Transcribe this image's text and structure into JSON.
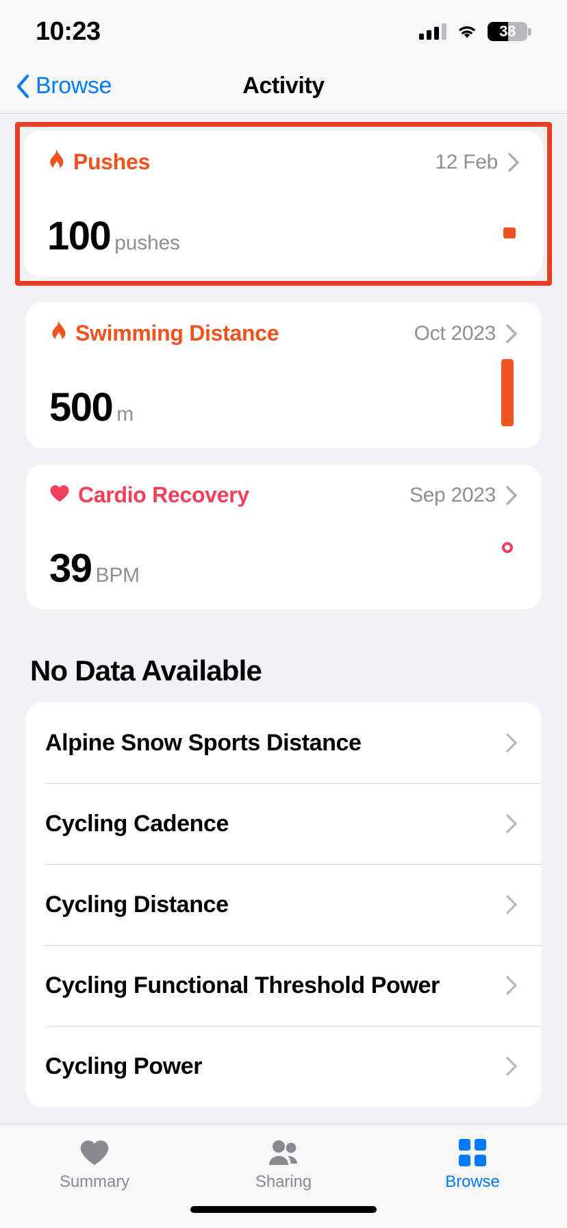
{
  "status_bar": {
    "time": "10:23",
    "battery_percent": "38",
    "signal_icon": "cellular-signal-icon",
    "wifi_icon": "wifi-icon",
    "battery_icon": "battery-icon"
  },
  "nav": {
    "back_label": "Browse",
    "back_icon": "chevron-left-icon",
    "title": "Activity"
  },
  "colors": {
    "accent_blue": "#007aff",
    "activity_orange": "#f0521f",
    "heart_red": "#f2405c",
    "highlight_border": "#ea3b23",
    "secondary_text": "#8e8e93",
    "page_background": "#f2f1f6"
  },
  "highlighted_card_index": 0,
  "cards": [
    {
      "icon": "flame-icon",
      "icon_color": "#f0521f",
      "title": "Pushes",
      "title_color": "orange",
      "date": "12 Feb",
      "value": "100",
      "unit": "pushes",
      "chevron_icon": "chevron-right-icon",
      "spark": {
        "kind": "bar-small",
        "color": "#f0521f"
      }
    },
    {
      "icon": "flame-icon",
      "icon_color": "#f0521f",
      "title": "Swimming Distance",
      "title_color": "orange",
      "date": "Oct 2023",
      "value": "500",
      "unit": "m",
      "chevron_icon": "chevron-right-icon",
      "spark": {
        "kind": "bar-tall",
        "color": "#ee5523"
      }
    },
    {
      "icon": "heart-icon",
      "icon_color": "#f2405c",
      "title": "Cardio Recovery",
      "title_color": "red",
      "date": "Sep 2023",
      "value": "39",
      "unit": "BPM",
      "chevron_icon": "chevron-right-icon",
      "spark": {
        "kind": "dot-ring",
        "color": "#f2405c"
      }
    }
  ],
  "no_data": {
    "section_title": "No Data Available",
    "items": [
      {
        "label": "Alpine Snow Sports Distance",
        "chevron_icon": "chevron-right-icon"
      },
      {
        "label": "Cycling Cadence",
        "chevron_icon": "chevron-right-icon"
      },
      {
        "label": "Cycling Distance",
        "chevron_icon": "chevron-right-icon"
      },
      {
        "label": "Cycling Functional Threshold Power",
        "chevron_icon": "chevron-right-icon"
      },
      {
        "label": "Cycling Power",
        "chevron_icon": "chevron-right-icon"
      }
    ]
  },
  "tabbar": {
    "tabs": [
      {
        "label": "Summary",
        "icon": "heart-icon",
        "active": false
      },
      {
        "label": "Sharing",
        "icon": "two-people-icon",
        "active": false
      },
      {
        "label": "Browse",
        "icon": "grid-squares-icon",
        "active": true
      }
    ]
  }
}
